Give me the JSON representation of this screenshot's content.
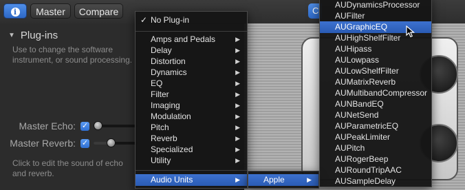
{
  "toolbar": {
    "master_label": "Master",
    "compare_label": "Compare",
    "info_glyph": "i",
    "partial_button_label": "C"
  },
  "panel": {
    "title": "Plug-ins",
    "description": "Use to change the software instrument, or sound processing.",
    "master_echo_label": "Master Echo:",
    "master_reverb_label": "Master Reverb:",
    "check_glyph": "✓",
    "footer": "Click to edit the sound of echo and reverb."
  },
  "menu1": {
    "no_plugin": "No Plug-in",
    "checkmark": "✓",
    "items": [
      "Amps and Pedals",
      "Delay",
      "Distortion",
      "Dynamics",
      "EQ",
      "Filter",
      "Imaging",
      "Modulation",
      "Pitch",
      "Reverb",
      "Specialized",
      "Utility"
    ],
    "audio_units": "Audio Units",
    "chevron": "▶"
  },
  "menu2": {
    "item": "Apple"
  },
  "menu3": {
    "items": [
      "AUDynamicsProcessor",
      "AUFilter",
      "AUGraphicEQ",
      "AUHighShelfFilter",
      "AUHipass",
      "AULowpass",
      "AULowShelfFilter",
      "AUMatrixReverb",
      "AUMultibandCompressor",
      "AUNBandEQ",
      "AUNetSend",
      "AUParametricEQ",
      "AUPeakLimiter",
      "AUPitch",
      "AURogerBeep",
      "AURoundTripAAC",
      "AUSampleDelay"
    ],
    "highlighted": "AUGraphicEQ"
  },
  "colors": {
    "accent": "#2d68c6",
    "highlight": "#3d72cf"
  }
}
